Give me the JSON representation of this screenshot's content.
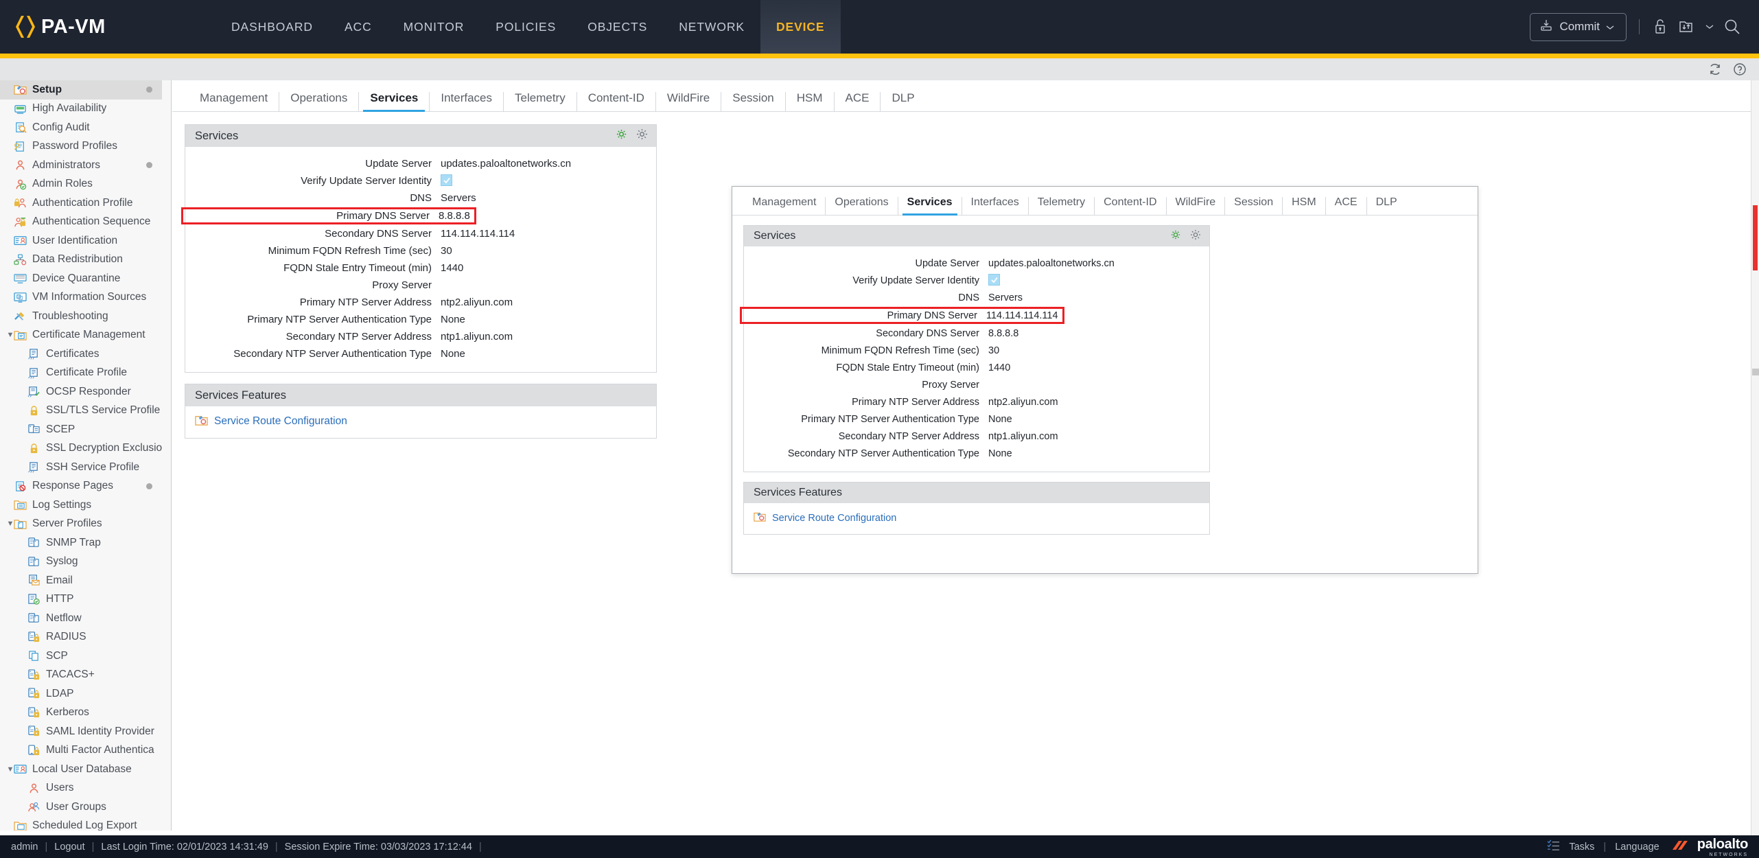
{
  "header": {
    "brand": "PA-VM",
    "logo_color": "#fdb715",
    "nav": [
      {
        "label": "DASHBOARD",
        "active": false
      },
      {
        "label": "ACC",
        "active": false
      },
      {
        "label": "MONITOR",
        "active": false
      },
      {
        "label": "POLICIES",
        "active": false
      },
      {
        "label": "OBJECTS",
        "active": false
      },
      {
        "label": "NETWORK",
        "active": false
      },
      {
        "label": "DEVICE",
        "active": true
      }
    ],
    "commit_label": "Commit",
    "accent_color": "#ffc20e",
    "active_tab_color": "#f5b424"
  },
  "sidebar": {
    "items": [
      {
        "label": "Setup",
        "icon": "setup-icon",
        "level": 0,
        "selected": true,
        "dot": true,
        "caret": ""
      },
      {
        "label": "High Availability",
        "icon": "high-availability-icon",
        "level": 0,
        "selected": false,
        "dot": false,
        "caret": ""
      },
      {
        "label": "Config Audit",
        "icon": "config-audit-icon",
        "level": 0,
        "selected": false,
        "dot": false,
        "caret": ""
      },
      {
        "label": "Password Profiles",
        "icon": "password-profiles-icon",
        "level": 0,
        "selected": false,
        "dot": false,
        "caret": ""
      },
      {
        "label": "Administrators",
        "icon": "administrators-icon",
        "level": 0,
        "selected": false,
        "dot": true,
        "caret": ""
      },
      {
        "label": "Admin Roles",
        "icon": "admin-roles-icon",
        "level": 0,
        "selected": false,
        "dot": false,
        "caret": ""
      },
      {
        "label": "Authentication Profile",
        "icon": "authentication-profile-icon",
        "level": 0,
        "selected": false,
        "dot": false,
        "caret": ""
      },
      {
        "label": "Authentication Sequence",
        "icon": "authentication-sequence-icon",
        "level": 0,
        "selected": false,
        "dot": false,
        "caret": ""
      },
      {
        "label": "User Identification",
        "icon": "user-identification-icon",
        "level": 0,
        "selected": false,
        "dot": false,
        "caret": ""
      },
      {
        "label": "Data Redistribution",
        "icon": "data-redistribution-icon",
        "level": 0,
        "selected": false,
        "dot": false,
        "caret": ""
      },
      {
        "label": "Device Quarantine",
        "icon": "device-quarantine-icon",
        "level": 0,
        "selected": false,
        "dot": false,
        "caret": ""
      },
      {
        "label": "VM Information Sources",
        "icon": "vm-information-sources-icon",
        "level": 0,
        "selected": false,
        "dot": false,
        "caret": ""
      },
      {
        "label": "Troubleshooting",
        "icon": "troubleshooting-icon",
        "level": 0,
        "selected": false,
        "dot": false,
        "caret": ""
      },
      {
        "label": "Certificate Management",
        "icon": "certificate-management-icon",
        "level": 0,
        "selected": false,
        "dot": false,
        "caret": "expanded"
      },
      {
        "label": "Certificates",
        "icon": "certificates-icon",
        "level": 1,
        "selected": false,
        "dot": false,
        "caret": ""
      },
      {
        "label": "Certificate Profile",
        "icon": "certificate-profile-icon",
        "level": 1,
        "selected": false,
        "dot": false,
        "caret": ""
      },
      {
        "label": "OCSP Responder",
        "icon": "ocsp-responder-icon",
        "level": 1,
        "selected": false,
        "dot": false,
        "caret": ""
      },
      {
        "label": "SSL/TLS Service Profile",
        "icon": "lock-icon",
        "level": 1,
        "selected": false,
        "dot": false,
        "caret": ""
      },
      {
        "label": "SCEP",
        "icon": "scep-icon",
        "level": 1,
        "selected": false,
        "dot": false,
        "caret": ""
      },
      {
        "label": "SSL Decryption Exclusio",
        "icon": "lock-icon",
        "level": 1,
        "selected": false,
        "dot": false,
        "caret": ""
      },
      {
        "label": "SSH Service Profile",
        "icon": "ssh-service-profile-icon",
        "level": 1,
        "selected": false,
        "dot": false,
        "caret": ""
      },
      {
        "label": "Response Pages",
        "icon": "response-pages-icon",
        "level": 0,
        "selected": false,
        "dot": true,
        "caret": ""
      },
      {
        "label": "Log Settings",
        "icon": "log-settings-icon",
        "level": 0,
        "selected": false,
        "dot": false,
        "caret": ""
      },
      {
        "label": "Server Profiles",
        "icon": "server-profiles-icon",
        "level": 0,
        "selected": false,
        "dot": false,
        "caret": "expanded"
      },
      {
        "label": "SNMP Trap",
        "icon": "snmp-trap-icon",
        "level": 1,
        "selected": false,
        "dot": false,
        "caret": ""
      },
      {
        "label": "Syslog",
        "icon": "syslog-icon",
        "level": 1,
        "selected": false,
        "dot": false,
        "caret": ""
      },
      {
        "label": "Email",
        "icon": "email-icon",
        "level": 1,
        "selected": false,
        "dot": false,
        "caret": ""
      },
      {
        "label": "HTTP",
        "icon": "http-icon",
        "level": 1,
        "selected": false,
        "dot": false,
        "caret": ""
      },
      {
        "label": "Netflow",
        "icon": "netflow-icon",
        "level": 1,
        "selected": false,
        "dot": false,
        "caret": ""
      },
      {
        "label": "RADIUS",
        "icon": "radius-icon",
        "level": 1,
        "selected": false,
        "dot": false,
        "caret": ""
      },
      {
        "label": "SCP",
        "icon": "scp-icon",
        "level": 1,
        "selected": false,
        "dot": false,
        "caret": ""
      },
      {
        "label": "TACACS+",
        "icon": "tacacs-icon",
        "level": 1,
        "selected": false,
        "dot": false,
        "caret": ""
      },
      {
        "label": "LDAP",
        "icon": "ldap-icon",
        "level": 1,
        "selected": false,
        "dot": false,
        "caret": ""
      },
      {
        "label": "Kerberos",
        "icon": "kerberos-icon",
        "level": 1,
        "selected": false,
        "dot": false,
        "caret": ""
      },
      {
        "label": "SAML Identity Provider",
        "icon": "saml-identity-provider-icon",
        "level": 1,
        "selected": false,
        "dot": false,
        "caret": ""
      },
      {
        "label": "Multi Factor Authentica",
        "icon": "multi-factor-auth-icon",
        "level": 1,
        "selected": false,
        "dot": false,
        "caret": ""
      },
      {
        "label": "Local User Database",
        "icon": "local-user-database-icon",
        "level": 0,
        "selected": false,
        "dot": false,
        "caret": "expanded"
      },
      {
        "label": "Users",
        "icon": "users-icon",
        "level": 1,
        "selected": false,
        "dot": false,
        "caret": ""
      },
      {
        "label": "User Groups",
        "icon": "user-groups-icon",
        "level": 1,
        "selected": false,
        "dot": false,
        "caret": ""
      },
      {
        "label": "Scheduled Log Export",
        "icon": "scheduled-log-export-icon",
        "level": 0,
        "selected": false,
        "dot": false,
        "caret": ""
      }
    ]
  },
  "main": {
    "tabs": [
      {
        "label": "Management",
        "active": false
      },
      {
        "label": "Operations",
        "active": false
      },
      {
        "label": "Services",
        "active": true
      },
      {
        "label": "Interfaces",
        "active": false
      },
      {
        "label": "Telemetry",
        "active": false
      },
      {
        "label": "Content-ID",
        "active": false
      },
      {
        "label": "WildFire",
        "active": false
      },
      {
        "label": "Session",
        "active": false
      },
      {
        "label": "HSM",
        "active": false
      },
      {
        "label": "ACE",
        "active": false
      },
      {
        "label": "DLP",
        "active": false
      }
    ],
    "services_panel": {
      "title": "Services",
      "rows": [
        {
          "label": "Update Server",
          "value": "updates.paloaltonetworks.cn",
          "type": "text",
          "highlight": false
        },
        {
          "label": "Verify Update Server Identity",
          "value": "",
          "type": "checkbox",
          "highlight": false
        },
        {
          "label": "DNS",
          "value": "Servers",
          "type": "text",
          "highlight": false
        },
        {
          "label": "Primary DNS Server",
          "value": "8.8.8.8",
          "type": "text",
          "highlight": true
        },
        {
          "label": "Secondary DNS Server",
          "value": "114.114.114.114",
          "type": "text",
          "highlight": false
        },
        {
          "label": "Minimum FQDN Refresh Time (sec)",
          "value": "30",
          "type": "text",
          "highlight": false
        },
        {
          "label": "FQDN Stale Entry Timeout (min)",
          "value": "1440",
          "type": "text",
          "highlight": false
        },
        {
          "label": "Proxy Server",
          "value": "",
          "type": "text",
          "highlight": false
        },
        {
          "label": "Primary NTP Server Address",
          "value": "ntp2.aliyun.com",
          "type": "text",
          "highlight": false
        },
        {
          "label": "Primary NTP Server Authentication Type",
          "value": "None",
          "type": "text",
          "highlight": false
        },
        {
          "label": "Secondary NTP Server Address",
          "value": "ntp1.aliyun.com",
          "type": "text",
          "highlight": false
        },
        {
          "label": "Secondary NTP Server Authentication Type",
          "value": "None",
          "type": "text",
          "highlight": false
        }
      ]
    },
    "features_panel": {
      "title": "Services Features",
      "link": "Service Route Configuration"
    }
  },
  "inset": {
    "tabs": [
      {
        "label": "Management",
        "active": false
      },
      {
        "label": "Operations",
        "active": false
      },
      {
        "label": "Services",
        "active": true
      },
      {
        "label": "Interfaces",
        "active": false
      },
      {
        "label": "Telemetry",
        "active": false
      },
      {
        "label": "Content-ID",
        "active": false
      },
      {
        "label": "WildFire",
        "active": false
      },
      {
        "label": "Session",
        "active": false
      },
      {
        "label": "HSM",
        "active": false
      },
      {
        "label": "ACE",
        "active": false
      },
      {
        "label": "DLP",
        "active": false
      }
    ],
    "services_panel": {
      "title": "Services",
      "rows": [
        {
          "label": "Update Server",
          "value": "updates.paloaltonetworks.cn",
          "type": "text",
          "highlight": false
        },
        {
          "label": "Verify Update Server Identity",
          "value": "",
          "type": "checkbox",
          "highlight": false
        },
        {
          "label": "DNS",
          "value": "Servers",
          "type": "text",
          "highlight": false
        },
        {
          "label": "Primary DNS Server",
          "value": "114.114.114.114",
          "type": "text",
          "highlight": true
        },
        {
          "label": "Secondary DNS Server",
          "value": "8.8.8.8",
          "type": "text",
          "highlight": false
        },
        {
          "label": "Minimum FQDN Refresh Time (sec)",
          "value": "30",
          "type": "text",
          "highlight": false
        },
        {
          "label": "FQDN Stale Entry Timeout (min)",
          "value": "1440",
          "type": "text",
          "highlight": false
        },
        {
          "label": "Proxy Server",
          "value": "",
          "type": "text",
          "highlight": false
        },
        {
          "label": "Primary NTP Server Address",
          "value": "ntp2.aliyun.com",
          "type": "text",
          "highlight": false
        },
        {
          "label": "Primary NTP Server Authentication Type",
          "value": "None",
          "type": "text",
          "highlight": false
        },
        {
          "label": "Secondary NTP Server Address",
          "value": "ntp1.aliyun.com",
          "type": "text",
          "highlight": false
        },
        {
          "label": "Secondary NTP Server Authentication Type",
          "value": "None",
          "type": "text",
          "highlight": false
        }
      ]
    },
    "features_panel": {
      "title": "Services Features",
      "link": "Service Route Configuration"
    }
  },
  "footer": {
    "user": "admin",
    "logout": "Logout",
    "last_login": "Last Login Time: 02/01/2023 14:31:49",
    "session_expire": "Session Expire Time: 03/03/2023 17:12:44",
    "tasks": "Tasks",
    "language": "Language",
    "vendor": "paloalto",
    "vendor_sub": "NETWORKS"
  },
  "highlight_color": "#ec2024"
}
